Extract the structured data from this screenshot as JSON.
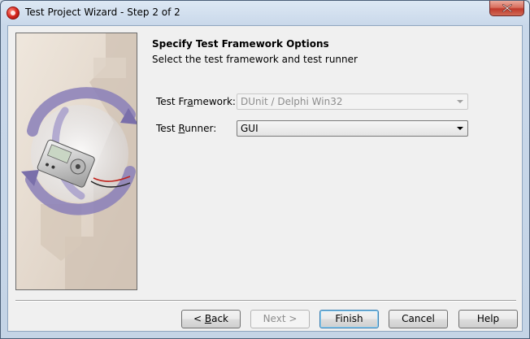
{
  "window": {
    "title": "Test Project Wizard - Step 2 of 2",
    "icon": "wizard-app-icon",
    "close_icon": "close-icon"
  },
  "page": {
    "heading": "Specify Test Framework Options",
    "subheading": "Select the test framework and test runner"
  },
  "fields": {
    "framework": {
      "label_pre": "Test Fr",
      "label_accel": "a",
      "label_post": "mework:",
      "value": "DUnit / Delphi Win32",
      "enabled": false
    },
    "runner": {
      "label_pre": "Test ",
      "label_accel": "R",
      "label_post": "unner:",
      "value": "GUI",
      "enabled": true
    }
  },
  "buttons": {
    "back": {
      "pre": "< ",
      "accel": "B",
      "post": "ack"
    },
    "next": {
      "label": "Next >",
      "enabled": false
    },
    "finish": {
      "label": "Finish"
    },
    "cancel": {
      "label": "Cancel"
    },
    "help": {
      "label": "Help"
    }
  },
  "colors": {
    "window_frame": "#c4d4e6",
    "dialog_background": "#f0f0f0",
    "close_button": "#c0392b",
    "image_arrows": "#8a7fb8"
  }
}
